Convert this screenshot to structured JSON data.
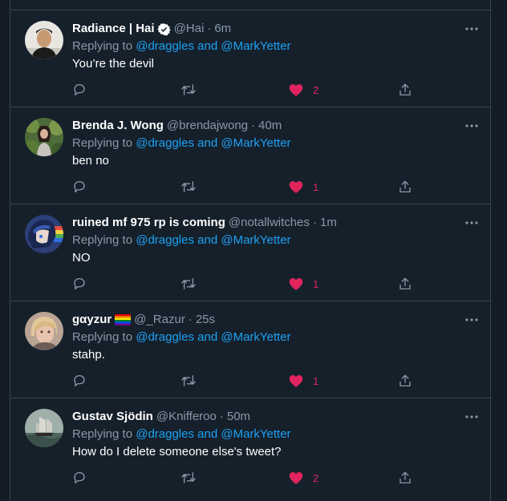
{
  "theme": {
    "background": "#15202b",
    "border": "#38444d",
    "text_primary": "#ffffff",
    "text_secondary": "#8899a6",
    "link": "#1da1f2",
    "like": "#e0245e"
  },
  "tweets": [
    {
      "display_name": "Radiance | Hai",
      "verified": true,
      "handle": "@Hai",
      "time": "6m",
      "reply_prefix": "Replying to",
      "reply_to": "@draggles and @MarkYetter",
      "text": "You’re the devil",
      "like_count": "2",
      "liked": true,
      "avatar_icon": "avatar-man-photo"
    },
    {
      "display_name": "Brenda J. Wong",
      "handle": "@brendajwong",
      "time": "40m",
      "reply_prefix": "Replying to",
      "reply_to": "@draggles and @MarkYetter",
      "text": "ben no",
      "like_count": "1",
      "liked": true,
      "avatar_icon": "avatar-woman-plants-photo"
    },
    {
      "display_name": "ruined mf 975 rp is coming",
      "handle": "@notallwitches",
      "time": "1m",
      "reply_prefix": "Replying to",
      "reply_to": "@draggles and @MarkYetter",
      "text": "NO",
      "like_count": "1",
      "liked": true,
      "avatar_icon": "avatar-anime-character"
    },
    {
      "display_name": "gαyzur",
      "flag_icon": "rainbow-flag-icon",
      "handle": "@_Razur",
      "time": "25s",
      "reply_prefix": "Replying to",
      "reply_to": "@draggles and @MarkYetter",
      "text": "stahp.",
      "like_count": "1",
      "liked": true,
      "avatar_icon": "avatar-person-blond-photo"
    },
    {
      "display_name": "Gustav Sjödin",
      "handle": "@Knifferoo",
      "time": "50m",
      "reply_prefix": "Replying to",
      "reply_to": "@draggles and @MarkYetter",
      "text": "How do I delete someone else's tweet?",
      "like_count": "2",
      "liked": true,
      "avatar_icon": "avatar-ship-painting"
    }
  ]
}
